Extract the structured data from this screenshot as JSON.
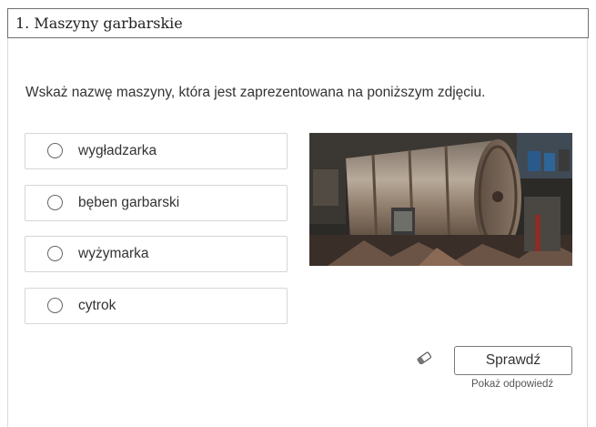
{
  "exercise": {
    "title": "1. Maszyny garbarskie",
    "question": "Wskaż nazwę maszyny, która jest zaprezentowana na poniższym zdjęciu.",
    "options": [
      {
        "label": "wygładzarka",
        "selected": false
      },
      {
        "label": "bęben garbarski",
        "selected": false
      },
      {
        "label": "wyżymarka",
        "selected": false
      },
      {
        "label": "cytrok",
        "selected": false
      }
    ],
    "image_icon": "tannery-drum-photo",
    "clear_icon": "eraser-icon",
    "check_label": "Sprawdź",
    "show_answer_label": "Pokaż odpowiedź"
  }
}
